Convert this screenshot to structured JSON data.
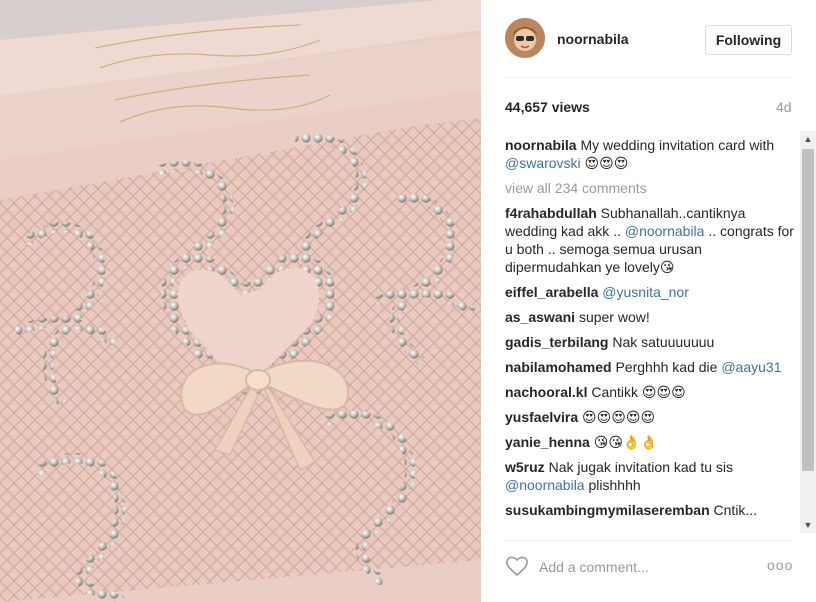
{
  "post": {
    "username": "noornabila",
    "follow_label": "Following",
    "views": "44,657 views",
    "age": "4d",
    "caption": {
      "user": "noornabila",
      "text": " My wedding invitation card with ",
      "mention": "@swarovski",
      "emoji": " 😍😍😍"
    },
    "view_all": "view all 234 comments",
    "add_comment_placeholder": "Add a comment...",
    "more_label": "ooo"
  },
  "comments": [
    {
      "user": "f4rahabdullah",
      "parts": [
        " Subhanallah..cantiknya wedding kad akk .. ",
        "@noornabila",
        " .. congrats for u both .. semoga semua urusan dipermudahkan ye lovely😘"
      ]
    },
    {
      "user": "eiffel_arabella",
      "parts": [
        " ",
        "@yusnita_nor",
        ""
      ]
    },
    {
      "user": "as_aswani",
      "parts": [
        " super wow!",
        "",
        ""
      ]
    },
    {
      "user": "gadis_terbilang",
      "parts": [
        " Nak satuuuuuuu",
        "",
        ""
      ]
    },
    {
      "user": "nabilamohamed",
      "parts": [
        " Perghhh kad die ",
        "@aayu31",
        ""
      ]
    },
    {
      "user": "nachooral.kl",
      "parts": [
        " Cantikk 😍😍😍",
        "",
        ""
      ]
    },
    {
      "user": "yusfaelvira",
      "parts": [
        " 😍😍😍😍😍",
        "",
        ""
      ]
    },
    {
      "user": "yanie_henna",
      "parts": [
        " 😘😘👌👌",
        "",
        ""
      ]
    },
    {
      "user": "w5ruz",
      "parts": [
        " Nak jugak invitation kad tu sis ",
        "@noornabila",
        " plishhhh"
      ]
    },
    {
      "user": "susukambingmymilaseremban",
      "parts": [
        " Cntik...",
        "",
        ""
      ]
    }
  ],
  "icons": {
    "heart": "heart-icon",
    "scroll_up": "scroll-up-arrow-icon",
    "scroll_down": "scroll-down-arrow-icon"
  },
  "colors": {
    "mention": "#3f729b",
    "muted": "#999999",
    "text": "#262626"
  }
}
